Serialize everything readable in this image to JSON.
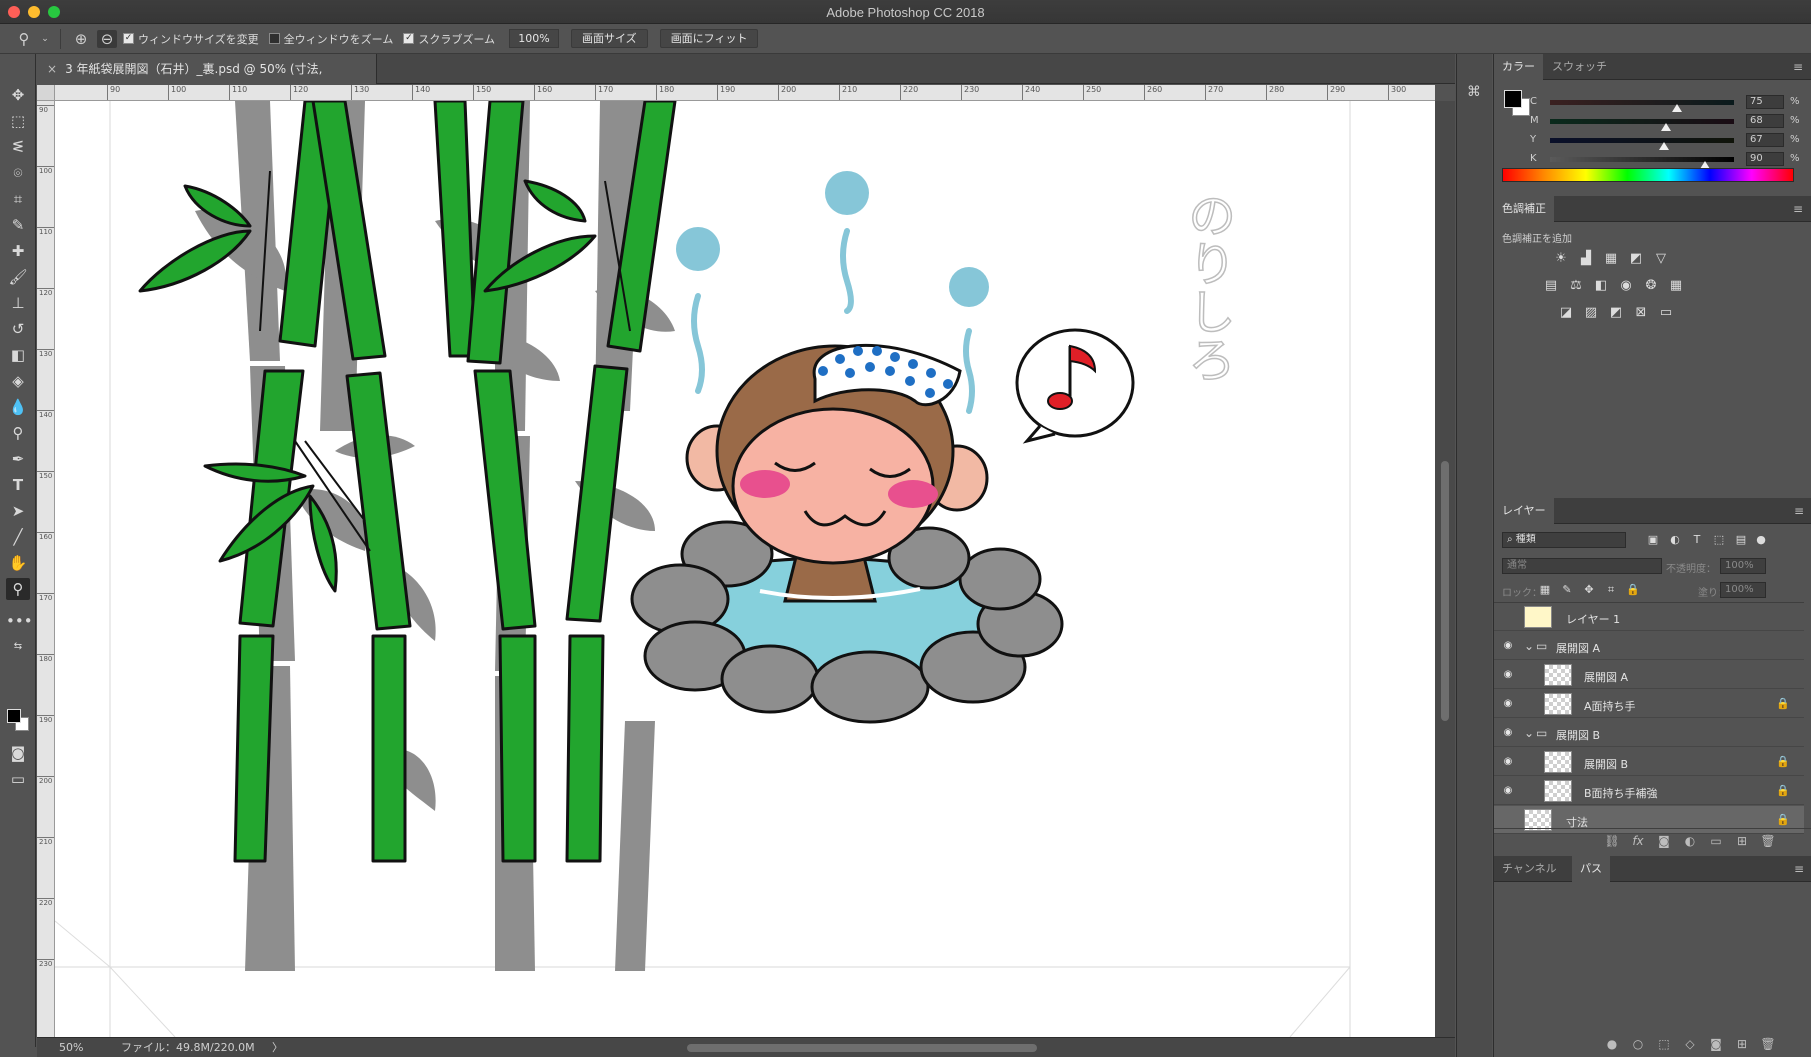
{
  "window": {
    "title": "Adobe Photoshop CC 2018"
  },
  "options": {
    "resize_windows": "ウィンドウサイズを変更",
    "zoom_all": "全ウィンドウをズーム",
    "scrubby_zoom": "スクラブズーム",
    "zoom_value": "100%",
    "screen_size": "画面サイズ",
    "fit_screen": "画面にフィット"
  },
  "document": {
    "tab_title": "3 年紙袋展開図（石井）_裏.psd @ 50% (寸法, RGB/8) *",
    "ruler_top": [
      "90",
      "100",
      "110",
      "120",
      "130",
      "140",
      "150",
      "160",
      "170",
      "180",
      "190",
      "200",
      "210",
      "220",
      "230",
      "240",
      "250",
      "260",
      "270",
      "280",
      "290",
      "300"
    ],
    "ruler_left": [
      "90",
      "100",
      "110",
      "120",
      "130",
      "140",
      "150",
      "160",
      "170",
      "180",
      "190",
      "200",
      "210",
      "220",
      "230"
    ],
    "vertical_text": "のりしろ"
  },
  "status": {
    "zoom": "50%",
    "file": "ファイル：49.8M/220.0M",
    "arrow": "〉"
  },
  "color_panel": {
    "tab_color": "カラー",
    "tab_swatches": "スウォッチ",
    "sliders": [
      {
        "label": "C",
        "value": "75",
        "pct": "%"
      },
      {
        "label": "M",
        "value": "68",
        "pct": "%"
      },
      {
        "label": "Y",
        "value": "67",
        "pct": "%"
      },
      {
        "label": "K",
        "value": "90",
        "pct": "%"
      }
    ]
  },
  "adjustments": {
    "tab": "色調補正",
    "add_label": "色調補正を追加"
  },
  "layers_panel": {
    "tab": "レイヤー",
    "kind": "種類",
    "blend": "通常",
    "opacity_label": "不透明度：",
    "opacity": "100%",
    "lock_label": "ロック：",
    "fill_label": "塗り：",
    "fill": "100%",
    "layers": [
      {
        "name": "レイヤー 1",
        "visible": false
      },
      {
        "name": "展開図 A",
        "group": true,
        "visible": true
      },
      {
        "name": "展開図 A",
        "visible": true
      },
      {
        "name": "A面持ち手",
        "visible": true,
        "locked": true
      },
      {
        "name": "展開図 B",
        "group": true,
        "visible": true
      },
      {
        "name": "展開図 B",
        "visible": true,
        "locked": true
      },
      {
        "name": "B面持ち手補強",
        "visible": true,
        "locked": true
      },
      {
        "name": "寸法",
        "visible": false,
        "locked": true,
        "selected": true
      }
    ]
  },
  "channels_panel": {
    "tab_channels": "チャンネル",
    "tab_paths": "パス"
  },
  "colors": {
    "bamboo": "#22a52e",
    "shadow": "#8e8e8e",
    "water": "#86d0dc",
    "steam": "#7ec3d6"
  }
}
